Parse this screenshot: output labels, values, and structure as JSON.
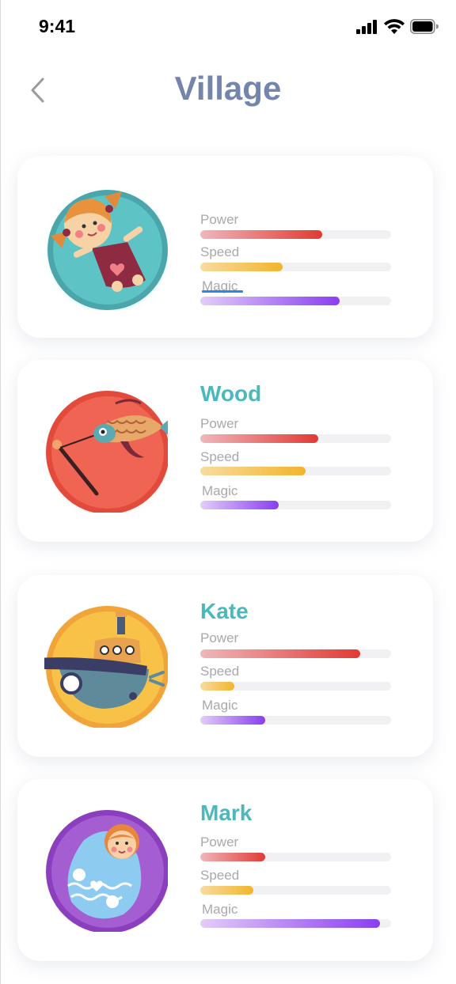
{
  "status_bar": {
    "time": "9:41"
  },
  "header": {
    "title": "Village"
  },
  "stat_labels": {
    "power": "Power",
    "speed": "Speed",
    "magic": "Magic"
  },
  "characters": [
    {
      "name": "",
      "avatar": "doll-icon",
      "ring_color": "#4aa6ab",
      "power": 0.64,
      "speed": 0.43,
      "magic": 0.73
    },
    {
      "name": "Wood",
      "avatar": "koi-flag-icon",
      "ring_color": "#e24a3c",
      "power": 0.62,
      "speed": 0.55,
      "magic": 0.41
    },
    {
      "name": "Kate",
      "avatar": "ship-icon",
      "ring_color": "#f0a43a",
      "power": 0.84,
      "speed": 0.18,
      "magic": 0.34
    },
    {
      "name": "Mark",
      "avatar": "matryoshka-icon",
      "ring_color": "#8b3fbf",
      "power": 0.34,
      "speed": 0.28,
      "magic": 0.94
    }
  ]
}
